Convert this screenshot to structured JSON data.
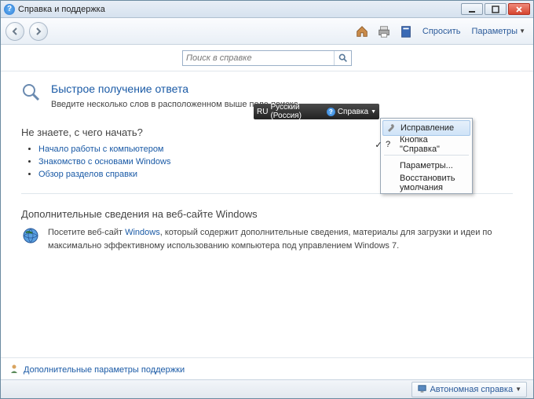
{
  "window": {
    "title": "Справка и поддержка"
  },
  "toolbar": {
    "ask_label": "Спросить",
    "params_label": "Параметры"
  },
  "search": {
    "placeholder": "Поиск в справке"
  },
  "quick": {
    "heading": "Быстрое получение ответа",
    "subtext": "Введите несколько слов в расположенном выше поле поиска."
  },
  "start": {
    "heading": "Не знаете, с чего начать?",
    "links": [
      "Начало работы с компьютером",
      "Знакомство с основами Windows",
      "Обзор разделов справки"
    ]
  },
  "web": {
    "heading": "Дополнительные сведения на веб-сайте Windows",
    "pre_text": "Посетите веб-сайт ",
    "link": "Windows",
    "post_text": ", который содержит дополнительные сведения, материалы для загрузки и идеи по максимально эффективному использованию компьютера под управлением ",
    "os": "Windows 7",
    "period": "."
  },
  "lang_bar": {
    "lang_code": "RU",
    "lang_name": "Русский (Россия)",
    "help_label": "Справка"
  },
  "dropdown": {
    "items": [
      {
        "label": "Исправление",
        "highlight": true,
        "icon": "wrench"
      },
      {
        "label": "Кнопка \"Справка\"",
        "highlight": false,
        "icon": "help",
        "checked": true
      },
      {
        "label": "Параметры...",
        "highlight": false
      },
      {
        "label": "Восстановить умолчания",
        "highlight": false
      }
    ]
  },
  "bottom_link": {
    "label": "Дополнительные параметры поддержки"
  },
  "statusbar": {
    "mode_label": "Автономная справка"
  }
}
